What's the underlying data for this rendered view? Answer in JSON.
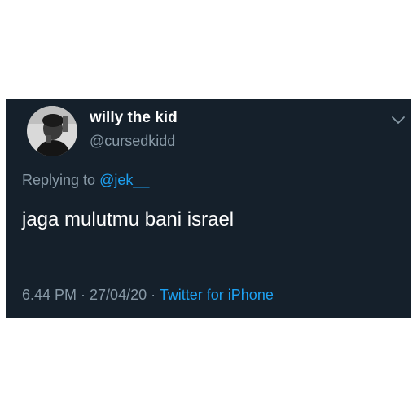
{
  "tweet": {
    "display_name": "willy the kid",
    "handle": "@cursedkidd",
    "replying_prefix": "Replying to ",
    "replying_to": "@jek__",
    "text": "jaga mulutmu bani israel",
    "timestamp": "6.44 PM · 27/04/20 · ",
    "source": "Twitter for iPhone",
    "menu_icon": "chevron-down-icon",
    "avatar_icon": "profile-photo"
  },
  "colors": {
    "background": "#15202b",
    "text_primary": "#ffffff",
    "text_secondary": "#8899a6",
    "accent": "#1da1f2"
  }
}
